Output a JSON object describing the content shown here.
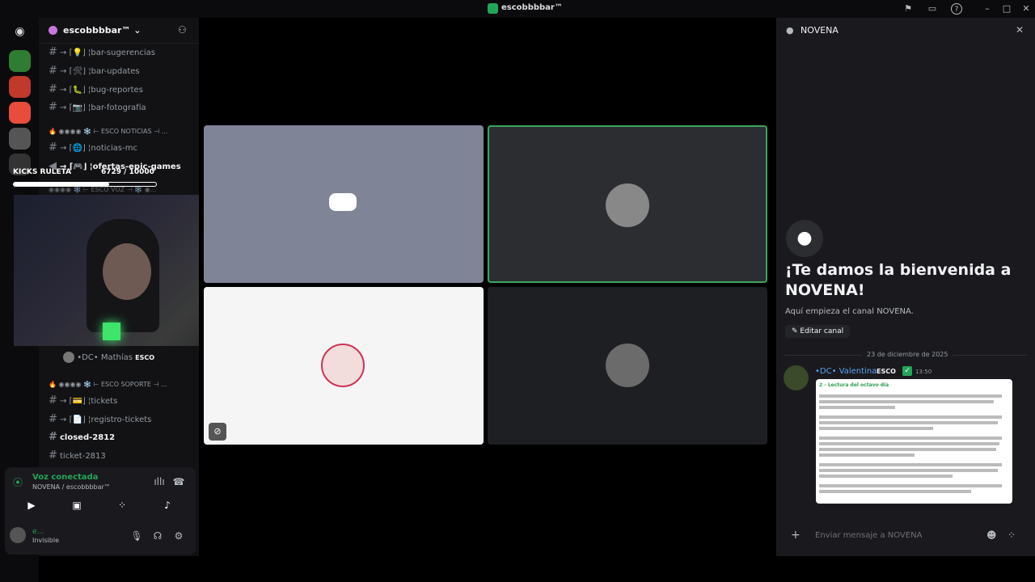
{
  "window": {
    "title": "escobbbbar™"
  },
  "server": {
    "name": "escobbbbar™ ⌄"
  },
  "channels": [
    {
      "label": "→ ⌈💡⌋ ¦bar-sugerencias"
    },
    {
      "label": "→ ⌈🛠⌋ ¦bar-updates"
    },
    {
      "label": "→ ⌈🐛⌋ ¦bug-reportes"
    },
    {
      "label": "→ ⌈📷⌋ ¦bar-fotografía"
    },
    {
      "label": "→ ⌈🌐⌋ ¦noticias-mc"
    },
    {
      "label": "→ ⌈🎮⌋ ¦ofertas-epic-games"
    },
    {
      "label": "→ ⌈💳⌋ ¦tickets"
    },
    {
      "label": "→ ⌈📄⌋ ¦registro-tickets"
    },
    {
      "label": "closed-2812"
    },
    {
      "label": "ticket-2813"
    }
  ],
  "categories": {
    "noticias": "🔥 ◉◉◉◉ ❄️ ⊢ ESCO NOTICIAS ⊣ ...",
    "voz": "◉◉◉◉ ❄️ ⊢ ESCO VOZ ⊣ ❄️ ◉...",
    "soporte": "🔥 ◉◉◉◉ ❄️ ⊢ ESCO SOPORTE ⊣ ..."
  },
  "voice_member": {
    "name": "•DC• Mathías",
    "tag": "ESCO"
  },
  "stream_overlay": {
    "title": "KICKS RULETA",
    "progress_text": "6729  / 10000",
    "progress": 0.67
  },
  "voice_status": {
    "title": "Voz conectada",
    "subtitle": "NOVENA / escobbbbar™"
  },
  "user": {
    "name": "e...",
    "status": "Invisible"
  },
  "right_panel": {
    "channel_name": "NOVENA",
    "welcome_title": "¡Te damos la bienvenida a NOVENA!",
    "welcome_sub": "Aquí empieza el canal NOVENA.",
    "edit_button": "Editar canal",
    "date_divider": "23 de diciembre de 2025",
    "message_author": "•DC• Valentina",
    "message_tag": "ESCO",
    "message_time": "13:50",
    "attachment_title": "2 - Lectura del octavo día",
    "input_placeholder": "Enviar mensaje a NOVENA"
  },
  "colors": {
    "accent": "#5865f2",
    "green": "#23a559",
    "speaking": "#3ba55c"
  }
}
